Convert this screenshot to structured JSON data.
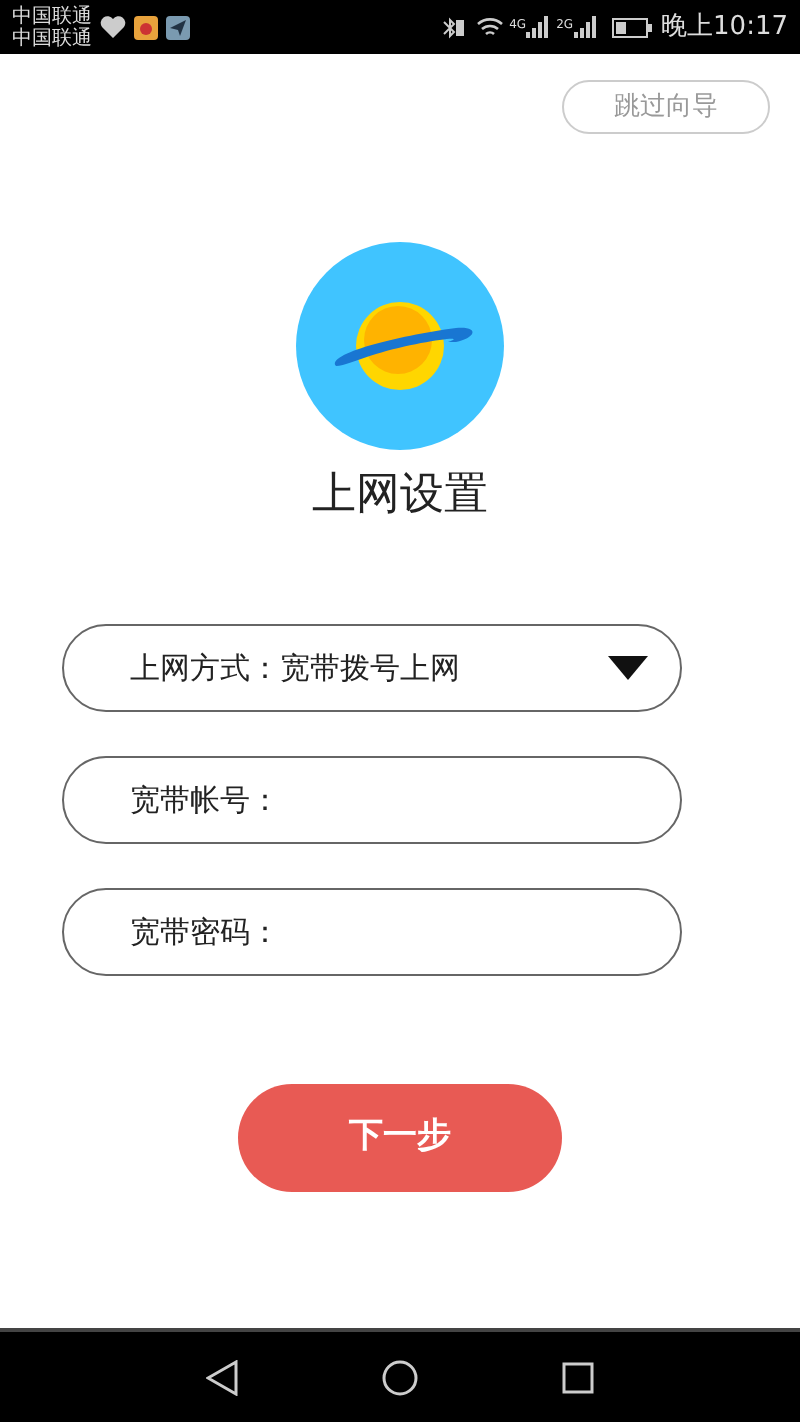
{
  "status_bar": {
    "carriers": [
      "中国联通",
      "中国联通"
    ],
    "networks": [
      "4G",
      "2G"
    ],
    "time": "晚上10:17"
  },
  "skip_button": "跳过向导",
  "title": "上网设置",
  "fields": [
    {
      "kind": "dropdown",
      "label": "上网方式：",
      "value": "宽带拨号上网"
    },
    {
      "kind": "text",
      "label": "宽带帐号："
    },
    {
      "kind": "text",
      "label": "宽带密码："
    }
  ],
  "next_button": "下一步"
}
